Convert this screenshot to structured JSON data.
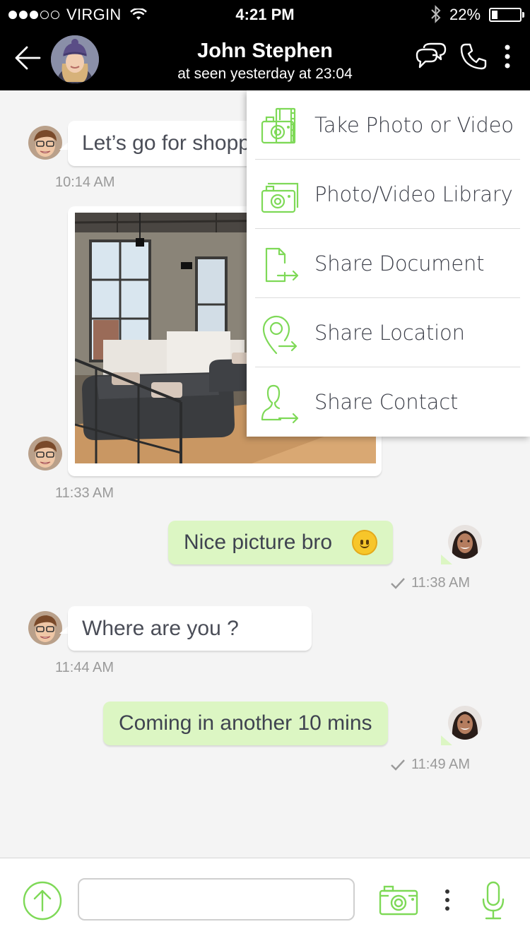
{
  "status_bar": {
    "carrier": "VIRGIN",
    "time": "4:21 PM",
    "battery": "22%",
    "battery_level": 0.22
  },
  "header": {
    "contact_name": "John Stephen",
    "last_seen": "at seen yesterday at 23:04",
    "icons": [
      "back-arrow-icon",
      "chat-bubbles-icon",
      "phone-icon",
      "more-vertical-icon"
    ]
  },
  "messages": [
    {
      "direction": "incoming",
      "type": "text",
      "text": "Let’s go for shopping",
      "time": "10:14 AM"
    },
    {
      "direction": "incoming",
      "type": "image",
      "time": "11:33 AM"
    },
    {
      "direction": "outgoing",
      "type": "text",
      "text": "Nice picture bro",
      "emoji": "slightly-smiling-face",
      "time": "11:38 AM",
      "status": "sent-check"
    },
    {
      "direction": "incoming",
      "type": "text",
      "text": "Where are you ?",
      "time": "11:44 AM"
    },
    {
      "direction": "outgoing",
      "type": "text",
      "text": "Coming in another 10 mins",
      "time": "11:49 AM",
      "status": "sent-check"
    }
  ],
  "attach_menu": {
    "items": [
      {
        "label": "Take Photo or Video",
        "icon": "camera-film-icon"
      },
      {
        "label": "Photo/Video Library",
        "icon": "camera-library-icon"
      },
      {
        "label": "Share Document",
        "icon": "document-share-icon"
      },
      {
        "label": "Share Location",
        "icon": "location-share-icon"
      },
      {
        "label": "Share Contact",
        "icon": "contact-share-icon"
      }
    ]
  },
  "composer": {
    "input_value": "",
    "input_placeholder": "",
    "icons": [
      "upload-arrow-icon",
      "camera-icon",
      "more-vertical-icon",
      "microphone-icon"
    ]
  },
  "colors": {
    "header_bg": "#000000",
    "accent_green": "#7ed957",
    "outgoing_bubble": "#dcf6c3",
    "incoming_bubble": "#ffffff",
    "chat_bg": "#f4f4f4"
  }
}
